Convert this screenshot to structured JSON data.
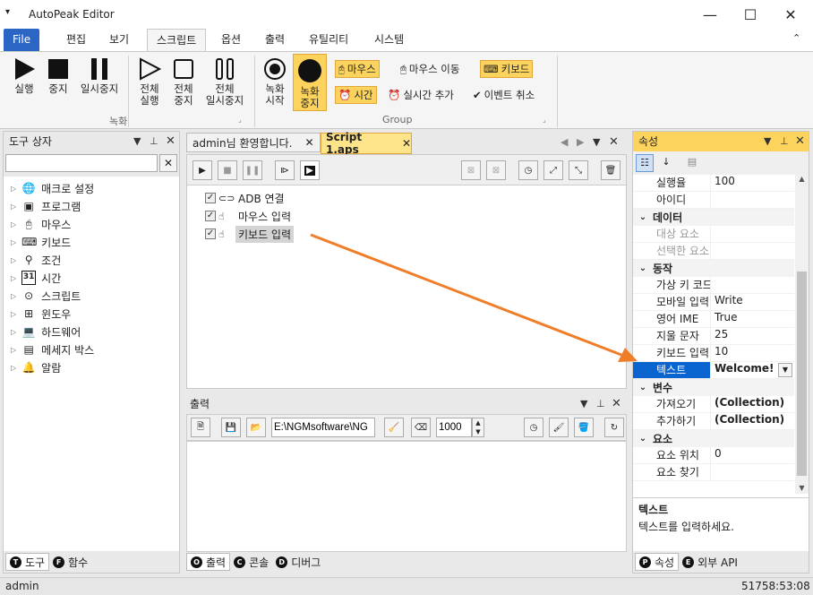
{
  "app": {
    "title": "AutoPeak Editor",
    "min_icon": "minimize-icon",
    "max_icon": "maximize-icon",
    "close_icon": "close-icon"
  },
  "ribbon_tabs": [
    "File",
    "편집",
    "보기",
    "스크립트",
    "옵션",
    "출력",
    "유틸리티",
    "시스템"
  ],
  "ribbon": {
    "record_buttons": [
      {
        "label": "실행",
        "icon": "play-icon"
      },
      {
        "label": "중지",
        "icon": "stop-icon"
      },
      {
        "label": "일시중지",
        "icon": "pause-icon"
      },
      {
        "label": "전체\n실행",
        "icon": "play-outline-icon"
      },
      {
        "label": "전체\n중지",
        "icon": "stop-outline-icon"
      },
      {
        "label": "전체\n일시중지",
        "icon": "pause-outline-icon"
      }
    ],
    "group1_label": "녹화",
    "record_start": "녹화\n시작",
    "record_stop": "녹화\n중지",
    "options": {
      "mouse": "마우스",
      "mouse_move": "마우스 이동",
      "keyboard": "키보드",
      "time": "시간",
      "realtime_add": "실시간 추가",
      "event_cancel": "이벤트 취소"
    },
    "group2_label": "Group"
  },
  "toolbox": {
    "title": "도구 상자",
    "search_placeholder": "",
    "items": [
      {
        "label": "매크로 설정",
        "icon": "globe-icon"
      },
      {
        "label": "프로그램",
        "icon": "program-icon"
      },
      {
        "label": "마우스",
        "icon": "mouse-icon"
      },
      {
        "label": "키보드",
        "icon": "keyboard-icon"
      },
      {
        "label": "조건",
        "icon": "condition-icon"
      },
      {
        "label": "시간",
        "icon": "calendar-icon"
      },
      {
        "label": "스크립트",
        "icon": "script-icon"
      },
      {
        "label": "윈도우",
        "icon": "windows-icon"
      },
      {
        "label": "하드웨어",
        "icon": "laptop-icon"
      },
      {
        "label": "메세지 박스",
        "icon": "message-icon"
      },
      {
        "label": "알람",
        "icon": "bell-icon"
      }
    ],
    "tabs": [
      {
        "letter": "T",
        "label": "도구"
      },
      {
        "label": "함수",
        "letter": "F"
      }
    ],
    "calendar_number": "31"
  },
  "editor": {
    "tabs": [
      "admin님 환영합니다.",
      "Script 1.aps"
    ],
    "script_items": [
      {
        "label": "ADB 연결",
        "checked": true,
        "icon": "link-icon"
      },
      {
        "label": "마우스 입력",
        "checked": true,
        "icon": "hand-pointer-icon"
      },
      {
        "label": "키보드 입력",
        "checked": true,
        "icon": "hand-pointer-icon",
        "selected": true
      }
    ]
  },
  "output": {
    "title": "출력",
    "path": "E:\\NGMsoftware\\NG",
    "count": "1000",
    "tabs": [
      {
        "letter": "O",
        "label": "출력"
      },
      {
        "letter": "C",
        "label": "콘솔"
      },
      {
        "letter": "D",
        "label": "디버그"
      }
    ]
  },
  "properties": {
    "title": "속성",
    "rows": [
      {
        "type": "row",
        "k": "실행율",
        "v": "100"
      },
      {
        "type": "row",
        "k": "아이디",
        "v": ""
      },
      {
        "type": "cat",
        "k": "데이터"
      },
      {
        "type": "row",
        "k": "대상 요소",
        "v": "",
        "gray": true
      },
      {
        "type": "row",
        "k": "선택한 요소",
        "v": "",
        "gray": true
      },
      {
        "type": "cat",
        "k": "동작"
      },
      {
        "type": "row",
        "k": "가상 키 코드",
        "v": ""
      },
      {
        "type": "row",
        "k": "모바일 입력",
        "v": "Write"
      },
      {
        "type": "row",
        "k": "영어 IME",
        "v": "True"
      },
      {
        "type": "row",
        "k": "지울 문자",
        "v": "25"
      },
      {
        "type": "row",
        "k": "키보드 입력",
        "v": "10"
      },
      {
        "type": "row",
        "k": "텍스트",
        "v": "Welcome!",
        "selected": true
      },
      {
        "type": "cat",
        "k": "변수"
      },
      {
        "type": "row",
        "k": "가져오기",
        "v": "(Collection)",
        "bold": true
      },
      {
        "type": "row",
        "k": "추가하기",
        "v": "(Collection)",
        "bold": true
      },
      {
        "type": "cat",
        "k": "요소"
      },
      {
        "type": "row",
        "k": "요소 위치",
        "v": "0"
      },
      {
        "type": "row",
        "k": "요소 찾기",
        "v": ""
      }
    ],
    "desc_title": "텍스트",
    "desc_text": "텍스트를 입력하세요.",
    "tabs": [
      {
        "letter": "P",
        "label": "속성"
      },
      {
        "letter": "E",
        "label": "외부 API"
      }
    ]
  },
  "status": {
    "user": "admin",
    "time": "51758:53:08"
  },
  "colors": {
    "accent": "#2b66c4",
    "highlight": "#fcd35c",
    "arrow": "#f07d28",
    "selection": "#0a64d0"
  }
}
